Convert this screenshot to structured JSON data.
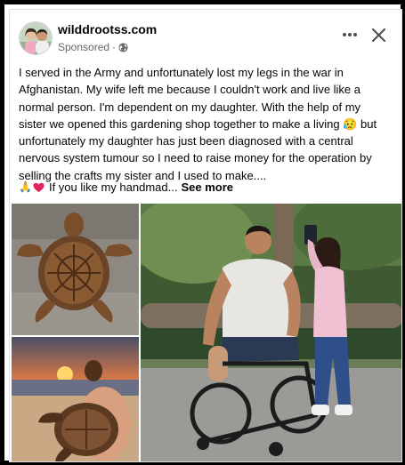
{
  "post": {
    "page_name": "wilddrootss.com",
    "sponsored_label": "Sponsored",
    "sponsored_dot": "·",
    "body": "I served in the Army and unfortunately lost my legs in the war in Afghanistan. My wife left me because I couldn't work and live like a normal person. I'm dependent on my daughter. With the help of my sister we opened this gardening shop together to make a living 😥 but unfortunately my daughter has just been diagnosed with a central nervous system tumour so I need to raise money for the operation by selling the crafts my sister and I used to make....",
    "teaser_emoji": "🙏",
    "teaser_text": "If you like my handmad...",
    "see_more": "See more"
  },
  "icons": {
    "avatar": "page-avatar",
    "audience": "globe-icon",
    "more": "more-dots-icon",
    "close": "close-icon",
    "heart": "red-heart-emoji"
  },
  "colors": {
    "text": "#050505",
    "secondary": "#65676b",
    "heart": "#e0245e"
  }
}
